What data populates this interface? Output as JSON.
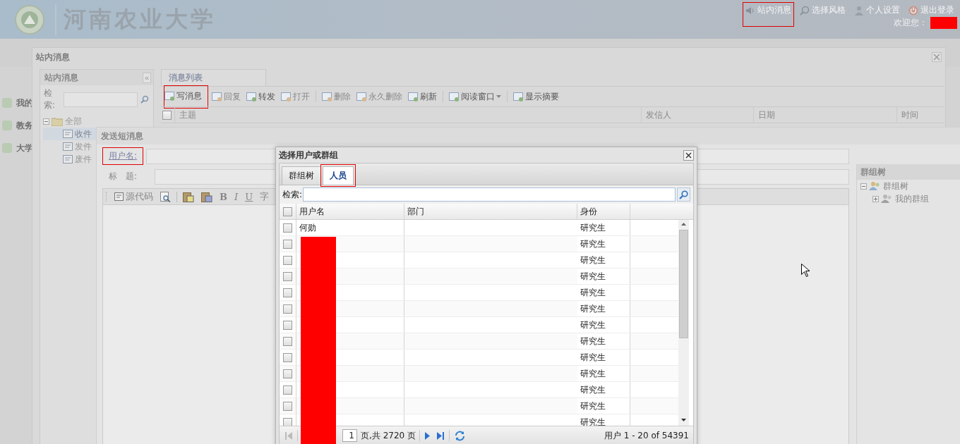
{
  "header": {
    "logo_text": "河南农业大学",
    "links": [
      {
        "label": "站内消息",
        "highlighted": true
      },
      {
        "label": "选择风格",
        "highlighted": false
      },
      {
        "label": "个人设置",
        "highlighted": false
      },
      {
        "label": "退出登录",
        "highlighted": false
      }
    ],
    "welcome": "欢迎您：",
    "user_redacted": true
  },
  "left_nav": {
    "items": [
      "我的",
      "教务",
      "大学"
    ]
  },
  "message_window": {
    "title": "站内消息",
    "sidebar": {
      "title": "站内消息",
      "collapse": "«",
      "search_label": "检索:",
      "tree": [
        {
          "label": "全部",
          "expanded": true,
          "children": [
            {
              "label": "收件",
              "selected": true
            },
            {
              "label": "发件",
              "selected": false
            },
            {
              "label": "废件",
              "selected": false
            }
          ]
        }
      ]
    },
    "tab": "消息列表",
    "toolbar": [
      {
        "label": "写消息",
        "disabled": false,
        "highlighted": true,
        "kind": "button"
      },
      {
        "label": "回复",
        "disabled": true,
        "highlighted": false,
        "kind": "button"
      },
      {
        "label": "转发",
        "disabled": false,
        "highlighted": false,
        "kind": "button"
      },
      {
        "label": "打开",
        "disabled": true,
        "highlighted": false,
        "kind": "button"
      },
      {
        "label": "删除",
        "disabled": true,
        "highlighted": false,
        "kind": "button",
        "separator_before": true
      },
      {
        "label": "永久删除",
        "disabled": true,
        "highlighted": false,
        "kind": "button"
      },
      {
        "label": "刷新",
        "disabled": false,
        "highlighted": false,
        "kind": "button"
      },
      {
        "label": "阅读窗口",
        "disabled": false,
        "highlighted": false,
        "kind": "dropdown",
        "separator_before": true
      },
      {
        "label": "显示摘要",
        "disabled": false,
        "highlighted": false,
        "kind": "button",
        "separator_before": true
      }
    ],
    "select_all_checked": false,
    "columns": [
      "主题",
      "发信人",
      "日期",
      "时间"
    ]
  },
  "compose_window": {
    "title": "发送短消息",
    "fields": [
      {
        "label": "用户名:",
        "kind": "link",
        "highlighted": true
      },
      {
        "label": "标　题:",
        "kind": "plain",
        "highlighted": false
      }
    ],
    "editor_toolbar": [
      {
        "label": "源代码",
        "kind": "source"
      },
      {
        "kind": "preview"
      },
      {
        "kind": "paste-text"
      },
      {
        "kind": "paste-word"
      },
      {
        "label": "B",
        "kind": "bold"
      },
      {
        "label": "I",
        "kind": "italic"
      },
      {
        "label": "U",
        "kind": "underline"
      },
      {
        "label": "字",
        "kind": "text"
      }
    ],
    "group_panel": {
      "title": "群组树",
      "tree": [
        {
          "label": "群组树",
          "expanded": true,
          "children": [
            {
              "label": "我的群组",
              "expanded": false
            }
          ]
        }
      ]
    }
  },
  "dialog": {
    "title": "选择用户或群组",
    "tabs": [
      {
        "label": "群组树",
        "selected": false,
        "highlighted": false
      },
      {
        "label": "人员",
        "selected": true,
        "highlighted": true
      }
    ],
    "search_label": "检索:",
    "select_all_checked": false,
    "columns": [
      "用户名",
      "部门",
      "身份"
    ],
    "rows": [
      {
        "name": "何勋",
        "identity": "研究生",
        "checked": false
      },
      {
        "identity": "研究生",
        "checked": false
      },
      {
        "identity": "研究生",
        "checked": false
      },
      {
        "identity": "研究生",
        "checked": false
      },
      {
        "identity": "研究生",
        "checked": false
      },
      {
        "identity": "研究生",
        "checked": false
      },
      {
        "identity": "研究生",
        "checked": false
      },
      {
        "identity": "研究生",
        "checked": false
      },
      {
        "identity": "研究生",
        "checked": false
      },
      {
        "identity": "研究生",
        "checked": false
      },
      {
        "identity": "研究生",
        "checked": false
      },
      {
        "identity": "研究生",
        "checked": false
      },
      {
        "identity": "研究生",
        "checked": false
      }
    ],
    "redacted": true,
    "pager": {
      "page": "1",
      "page_total": "页,共 2720 页",
      "summary": "用户 1 - 20 of 54391"
    }
  }
}
